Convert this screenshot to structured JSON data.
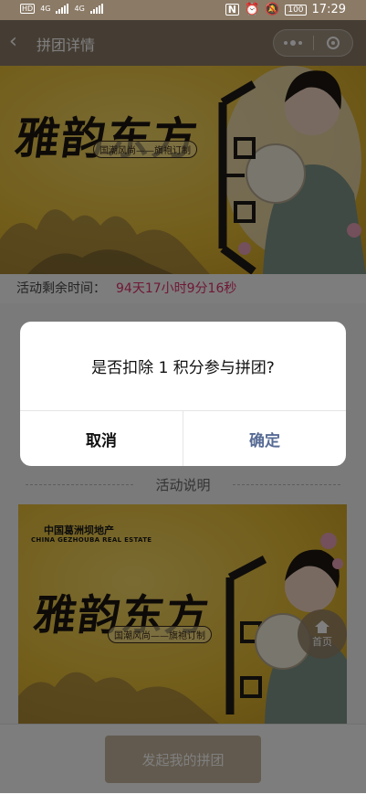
{
  "status_bar": {
    "left_indicators": [
      "HD",
      "4G",
      "4G"
    ],
    "time": "17:29",
    "battery": "100",
    "icons": [
      "nfc-icon",
      "alarm-icon",
      "mute-icon",
      "battery-icon"
    ]
  },
  "nav": {
    "back_icon": "chevron-left-icon",
    "title": "拼团详情",
    "capsule_icons": [
      "more-dots-icon",
      "close-target-icon"
    ]
  },
  "banner": {
    "calligraphy": "雅韵东方",
    "tagline": "国潮风尚——旗袍订制"
  },
  "countdown": {
    "label": "活动剩余时间：",
    "value": "94天17小时9分16秒",
    "value_color": "#e0306a"
  },
  "section": {
    "title": "活动说明"
  },
  "banner2": {
    "logo_cn": "中国葛洲坝地产",
    "logo_en": "CHINA GEZHOUBA REAL ESTATE",
    "calligraphy": "雅韵东方",
    "tagline": "国潮风尚——旗袍订制"
  },
  "float_home": {
    "icon": "home-icon",
    "label": "首页"
  },
  "bottom": {
    "launch_label": "发起我的拼团"
  },
  "dialog": {
    "message": "是否扣除 1 积分参与拼团?",
    "cancel_label": "取消",
    "confirm_label": "确定",
    "confirm_color": "#576b95"
  },
  "colors": {
    "nav_bg": "#8b7a66",
    "button_bg": "#c4b49c",
    "banner_gold": "#e5bb35"
  }
}
